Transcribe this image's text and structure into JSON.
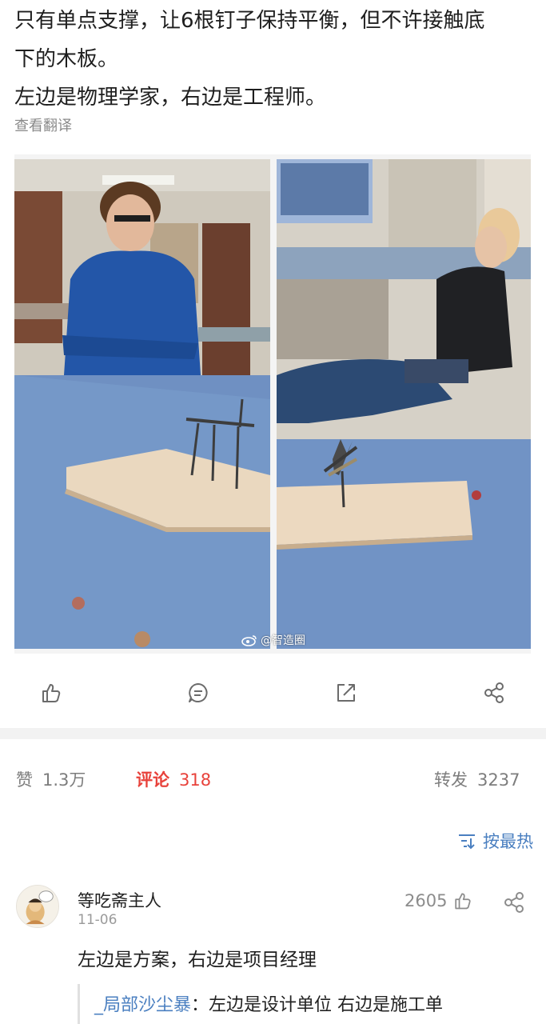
{
  "post": {
    "lines": [
      "只有单点支撑，让6根钉子保持平衡，但不许接触底",
      "下的木板。",
      "左边是物理学家，右边是工程师。"
    ],
    "translate_label": "查看翻译",
    "watermark": "@智造圈"
  },
  "stats": {
    "likes_label": "赞",
    "likes_count": "1.3万",
    "comments_label": "评论",
    "comments_count": "318",
    "reposts_label": "转发",
    "reposts_count": "3237"
  },
  "sort": {
    "label": "按最热"
  },
  "comment": {
    "author": "等吃斋主人",
    "date": "11-06",
    "likes": "2605",
    "text": "左边是方案，右边是项目经理",
    "reply_user": "_局部沙尘暴",
    "reply_sep": "：",
    "reply_text": "左边是设计单位 右边是施工单"
  },
  "colors": {
    "accent_red": "#e8423b",
    "link_blue": "#4a7fc0",
    "muted": "#8a8a8a"
  },
  "icons": [
    "like-icon",
    "comment-icon",
    "repost-icon",
    "share-icon",
    "sort-icon"
  ]
}
